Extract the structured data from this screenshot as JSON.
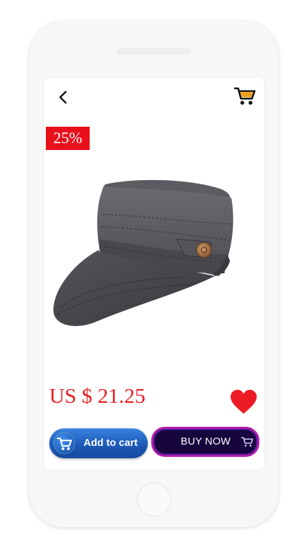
{
  "product": {
    "discount_badge": "25%",
    "price": "US $ 21.25",
    "image_icon": "cap-icon"
  },
  "actions": {
    "add_to_cart_label": "Add to cart",
    "buy_now_label": "BUY NOW"
  },
  "header": {
    "back_icon": "chevron-left-icon",
    "cart_icon": "shopping-cart-icon"
  },
  "colors": {
    "accent_red": "#ea1c24",
    "badge_red": "#e8101b",
    "add_cart_blue": "#1c5ab8",
    "buy_now_dark": "#16063d",
    "buy_now_border": "#b61ea8"
  }
}
